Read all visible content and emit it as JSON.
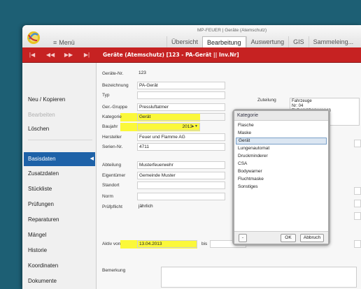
{
  "window": {
    "title": "MP-FEUER | Geräte (Atemschutz)"
  },
  "menu": {
    "label": "Menü"
  },
  "tabs": [
    "Übersicht",
    "Bearbeitung",
    "Auswertung",
    "GIS",
    "Sammeleing..."
  ],
  "active_tab": "Bearbeitung",
  "toolbar": {
    "title": "Geräte (Atemschutz)  [123 - PA-Gerät || Inv.Nr]"
  },
  "sidebar": {
    "actions": [
      "Neu / Kopieren",
      "Bearbeiten",
      "Löschen"
    ],
    "items": [
      "Basisdaten",
      "Zusatzdaten",
      "Stückliste",
      "Prüfungen",
      "Reparaturen",
      "Mängel",
      "Historie",
      "Koordinaten",
      "Dokumente"
    ],
    "active": "Basisdaten"
  },
  "form": {
    "geraete_nr": {
      "label": "Geräte-Nr.",
      "value": "123"
    },
    "bezeichnung": {
      "label": "Bezeichnung",
      "value": "PA-Gerät"
    },
    "typ": {
      "label": "Typ",
      "value": ""
    },
    "ger_gruppe": {
      "label": "Ger.-Gruppe",
      "value": "Pressluftatmer"
    },
    "kategorie": {
      "label": "Kategorie",
      "value": "Gerät"
    },
    "baujahr": {
      "label": "Baujahr",
      "value": "2013"
    },
    "hersteller": {
      "label": "Hersteller",
      "value": "Feuer und Flamme AG"
    },
    "serien_nr": {
      "label": "Serien-Nr.",
      "value": "4711"
    },
    "abteilung": {
      "label": "Abteilung",
      "value": "Musterfeuerwehr"
    },
    "eigentuemer": {
      "label": "Eigentümer",
      "value": "Gemeinde Muster"
    },
    "standort": {
      "label": "Standort",
      "value": ""
    },
    "norm": {
      "label": "Norm",
      "value": ""
    },
    "pruefpflicht": {
      "label": "Prüfpflicht",
      "value": "jährlich"
    },
    "aktiv_von": {
      "label": "Aktiv von",
      "value": "13.04.2013"
    },
    "bis": {
      "label": "bis",
      "value": ""
    },
    "bemerkung": {
      "label": "Bemerkung",
      "value": ""
    }
  },
  "zuteilung": {
    "label": "Zuteilung",
    "lines": [
      "Fahrzeuge",
      "Nr: 04",
      "TLF 16/25  MU-Y-143",
      "am: 12.04.2014"
    ],
    "add_label": "+"
  },
  "kategorie_popup": {
    "title": "Kategorie",
    "options": [
      "Flasche",
      "Maske",
      "Gerät",
      "Lungenautomat",
      "Druckminderer",
      "CSA",
      "Bodywarner",
      "Fluchtmaske",
      "Sonstiges"
    ],
    "selected": "Gerät",
    "minus_label": "-",
    "ok_label": "OK",
    "cancel_label": "Abbruch"
  },
  "colors": {
    "toolbar": "#c62222",
    "sidebar_active": "#1e62a8",
    "highlight": "#fbf83a",
    "desktop": "#1d5f74"
  }
}
